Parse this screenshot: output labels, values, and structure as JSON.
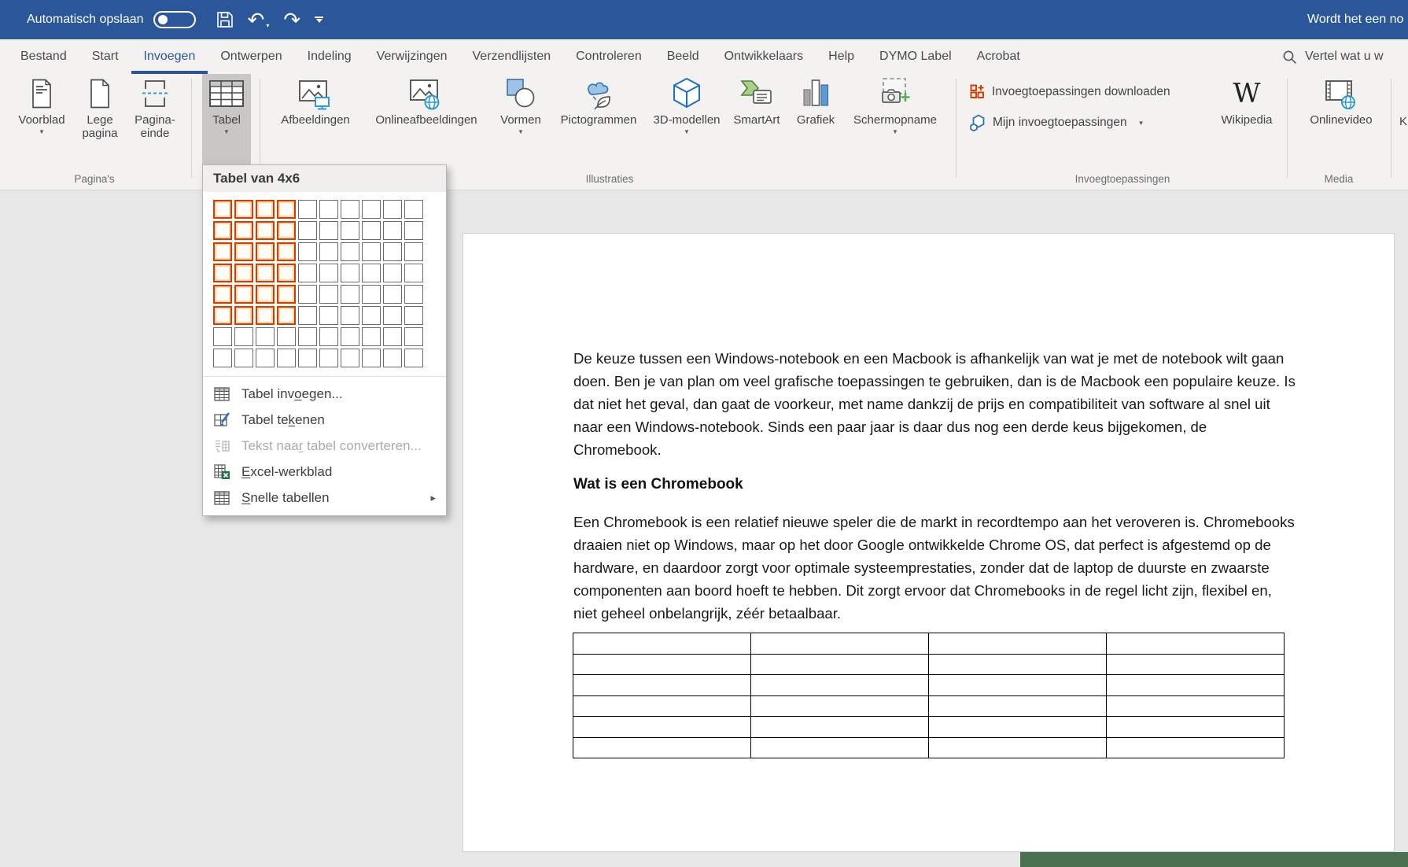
{
  "titlebar": {
    "autosave_label": "Automatisch opslaan",
    "autosave_state": "off",
    "document_hint": "Wordt het een no"
  },
  "tabs": [
    {
      "label": "Bestand",
      "active": false
    },
    {
      "label": "Start",
      "active": false
    },
    {
      "label": "Invoegen",
      "active": true
    },
    {
      "label": "Ontwerpen",
      "active": false
    },
    {
      "label": "Indeling",
      "active": false
    },
    {
      "label": "Verwijzingen",
      "active": false
    },
    {
      "label": "Verzendlijsten",
      "active": false
    },
    {
      "label": "Controleren",
      "active": false
    },
    {
      "label": "Beeld",
      "active": false
    },
    {
      "label": "Ontwikkelaars",
      "active": false
    },
    {
      "label": "Help",
      "active": false
    },
    {
      "label": "DYMO Label",
      "active": false
    },
    {
      "label": "Acrobat",
      "active": false
    }
  ],
  "search": {
    "label": "Vertel wat u w"
  },
  "ribbon": {
    "groups": [
      {
        "label": "Pagina's",
        "buttons": [
          {
            "label": "Voorblad",
            "dropdown": true
          },
          {
            "label": "Lege pagina",
            "dropdown": false
          },
          {
            "label": "Pagina-einde",
            "dropdown": false
          }
        ]
      },
      {
        "label": "",
        "buttons": [
          {
            "label": "Tabel",
            "dropdown": true,
            "pressed": true
          }
        ]
      },
      {
        "label": "Illustraties",
        "buttons": [
          {
            "label": "Afbeeldingen",
            "dropdown": false
          },
          {
            "label": "Onlineafbeeldingen",
            "dropdown": false
          },
          {
            "label": "Vormen",
            "dropdown": true
          },
          {
            "label": "Pictogrammen",
            "dropdown": false
          },
          {
            "label": "3D-modellen",
            "dropdown": true
          },
          {
            "label": "SmartArt",
            "dropdown": false
          },
          {
            "label": "Grafiek",
            "dropdown": false
          },
          {
            "label": "Schermopname",
            "dropdown": true
          }
        ]
      },
      {
        "label": "Invoegtoepassingen",
        "buttons": [
          {
            "label": "Invoegtoepassingen downloaden",
            "dropdown": false
          },
          {
            "label": "Mijn invoegtoepassingen",
            "dropdown": true
          },
          {
            "label": "Wikipedia",
            "dropdown": false
          }
        ]
      },
      {
        "label": "Media",
        "buttons": [
          {
            "label": "Onlinevideo",
            "dropdown": false
          }
        ]
      }
    ],
    "partial_group_text": "K"
  },
  "table_dropdown": {
    "header": "Tabel van 4x6",
    "grid": {
      "cols": 10,
      "rows": 8,
      "selected_cols": 4,
      "selected_rows": 6
    },
    "items": [
      {
        "name": "insert-table",
        "icon": "insert-table-icon",
        "pre": "Tabel inv",
        "key": "o",
        "post": "egen...",
        "disabled": false,
        "submenu": false
      },
      {
        "name": "draw-table",
        "icon": "draw-table-icon",
        "pre": "Tabel te",
        "key": "k",
        "post": "enen",
        "disabled": false,
        "submenu": false
      },
      {
        "name": "convert-text-to-table",
        "icon": "convert-text-icon",
        "pre": "Tekst naa",
        "key": "r",
        "post": " tabel converteren...",
        "disabled": true,
        "submenu": false
      },
      {
        "name": "excel-spreadsheet",
        "icon": "excel-icon",
        "pre": "",
        "key": "E",
        "post": "xcel-werkblad",
        "disabled": false,
        "submenu": false
      },
      {
        "name": "quick-tables",
        "icon": "quick-tables-icon",
        "pre": "",
        "key": "S",
        "post": "nelle tabellen",
        "disabled": false,
        "submenu": true
      }
    ]
  },
  "document": {
    "paragraph1": "De keuze tussen een Windows-notebook en een Macbook is afhankelijk van wat je met de notebook wilt gaan doen. Ben je van plan om veel grafische toepassingen te gebruiken, dan is de Macbook een populaire keuze. Is dat niet het geval, dan gaat de voorkeur, met name dankzij de prijs en compatibiliteit van software al snel uit naar een Windows-notebook. Sinds een paar jaar is daar dus nog een derde keus bijgekomen, de Chromebook.",
    "heading": "Wat is een Chromebook",
    "paragraph2": "Een Chromebook is een relatief nieuwe speler die de markt in recordtempo aan het veroveren is. Chromebooks draaien niet op Windows, maar op het door Google ontwikkelde Chrome OS, dat perfect is afgestemd op de hardware, en daardoor zorgt voor optimale systeemprestaties, zonder dat de laptop de duurste en zwaarste componenten aan boord hoeft te hebben. Dit zorgt ervoor dat Chromebooks in de regel licht zijn, flexibel en, niet geheel onbelangrijk, zéér betaalbaar.",
    "table": {
      "rows": 6,
      "cols": 4
    }
  },
  "colors": {
    "titlebar_blue": "#2b579a",
    "selection_orange": "#d83b01",
    "pressed_gray": "#c9c7c5",
    "background_green_strip": "#4a7150"
  }
}
